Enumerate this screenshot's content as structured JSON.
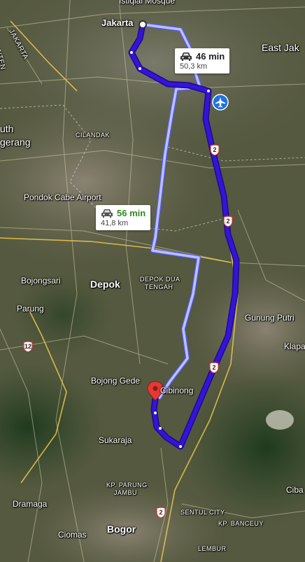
{
  "labels": {
    "istiqlal": "Istiqlal Mosque",
    "jakarta": "Jakarta",
    "jakarta_rot": "JAKARTA",
    "banten": "NTEN",
    "east_jakarta": "East Jak",
    "south_tangerang_1": "uth",
    "south_tangerang_2": "gerang",
    "cilandak": "CILANDAK",
    "pondok_cabe": "Pondok Cabe Airport",
    "bojongsari": "Bojongsari",
    "depok": "Depok",
    "depok_dua_1": "DEPOK DUA",
    "depok_dua_2": "TENGAH",
    "parung": "Parung",
    "gunung_putri": "Gunung Putri",
    "klapa": "Klapa",
    "bojong_gede": "Bojong Gede",
    "cibinong": "Cibinong",
    "sukaraja": "Sukaraja",
    "kp_parung_1": "KP. PARUNG",
    "kp_parung_2": "JAMBU",
    "dramaga": "Dramaga",
    "sentul": "SENTUL CITY",
    "banceuy": "KP. BANCEUY",
    "ciomas": "Ciomas",
    "bogor": "Bogor",
    "lembur": "LEMBUR",
    "ciba": "Ciba"
  },
  "route_primary": {
    "time": "46 min",
    "distance": "50,3 km",
    "color": "#3a1ee0"
  },
  "route_alt": {
    "time": "56 min",
    "distance": "41,8 km",
    "color": "#2e8b1e"
  },
  "shields": [
    "2",
    "2",
    "2",
    "12",
    "2"
  ],
  "colors": {
    "route": "#3413d9",
    "route_outline": "#1a0a8a",
    "alt_route": "#a9b6ff",
    "pin": "#e53935",
    "airport": "#1a73e8"
  },
  "icons": [
    "car-icon",
    "airport-icon",
    "destination-pin-icon",
    "origin-marker-icon"
  ]
}
